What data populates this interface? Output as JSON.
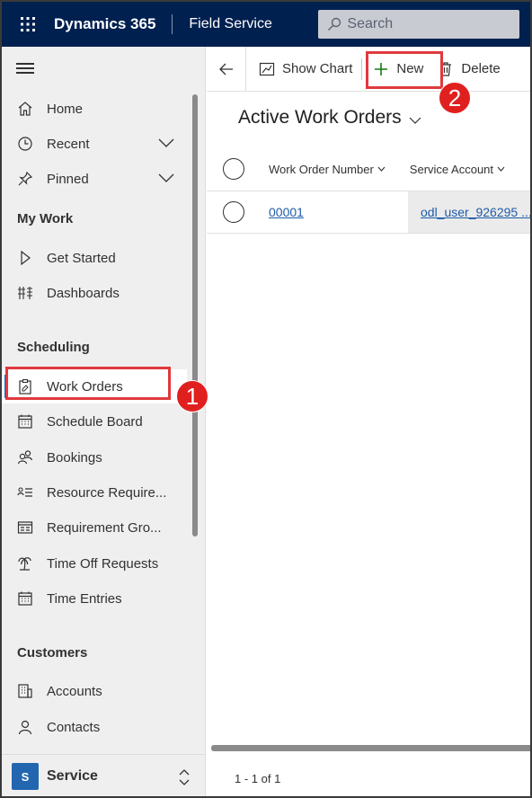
{
  "header": {
    "brand": "Dynamics 365",
    "app_name": "Field Service",
    "search_placeholder": "Search"
  },
  "sidebar": {
    "top_items": [
      {
        "label": "Home",
        "icon": "home-icon"
      },
      {
        "label": "Recent",
        "icon": "clock-icon",
        "expandable": true
      },
      {
        "label": "Pinned",
        "icon": "pin-icon",
        "expandable": true
      }
    ],
    "sections": [
      {
        "title": "My Work",
        "items": [
          {
            "label": "Get Started",
            "icon": "play-icon"
          },
          {
            "label": "Dashboards",
            "icon": "dashboard-icon"
          }
        ]
      },
      {
        "title": "Scheduling",
        "items": [
          {
            "label": "Work Orders",
            "icon": "clipboard-icon",
            "selected": true
          },
          {
            "label": "Schedule Board",
            "icon": "calendar-icon"
          },
          {
            "label": "Bookings",
            "icon": "people-icon"
          },
          {
            "label": "Resource Require...",
            "icon": "list-icon"
          },
          {
            "label": "Requirement Gro...",
            "icon": "card-icon"
          },
          {
            "label": "Time Off Requests",
            "icon": "palm-tree-icon"
          },
          {
            "label": "Time Entries",
            "icon": "calendar-icon"
          }
        ]
      },
      {
        "title": "Customers",
        "items": [
          {
            "label": "Accounts",
            "icon": "building-icon"
          },
          {
            "label": "Contacts",
            "icon": "person-icon"
          }
        ]
      }
    ],
    "area": {
      "badge": "S",
      "label": "Service"
    }
  },
  "commandbar": {
    "show_chart": "Show Chart",
    "new": "New",
    "delete": "Delete"
  },
  "view": {
    "title": "Active Work Orders",
    "columns": [
      "Work Order Number",
      "Service Account"
    ],
    "rows": [
      {
        "work_order_number": "00001",
        "service_account": "odl_user_926295 ..."
      }
    ],
    "paging": "1 - 1 of 1"
  },
  "annotations": {
    "marker1": "1",
    "marker2": "2",
    "color": "#e0393e"
  },
  "colors": {
    "topbar": "#002050",
    "accent": "#1a5fb4",
    "link": "#1e5ba8"
  }
}
